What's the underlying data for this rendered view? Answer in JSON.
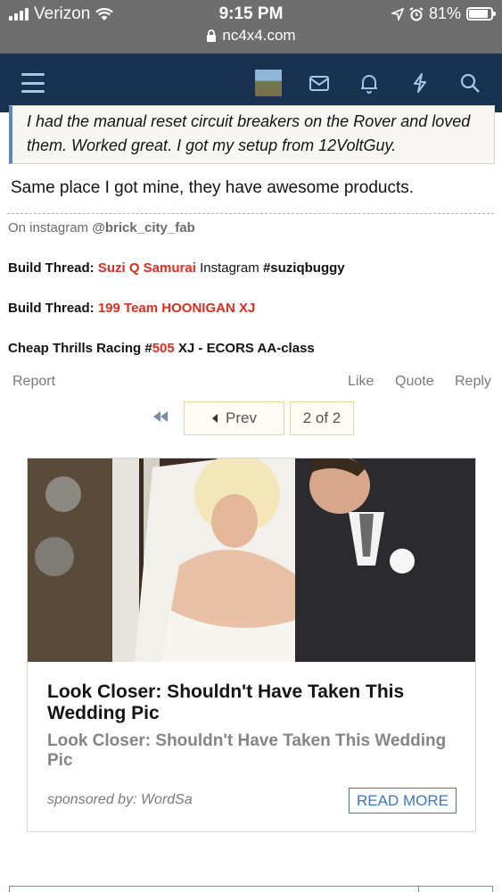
{
  "status_bar": {
    "carrier": "Verizon",
    "time": "9:15 PM",
    "battery": "81%",
    "url": "nc4x4.com"
  },
  "nav": {
    "icons": [
      "menu-icon",
      "avatar",
      "inbox-icon",
      "bell-icon",
      "whats-new-icon",
      "search-icon"
    ]
  },
  "post": {
    "quote": "I had the manual reset circuit breakers on the Rover and loved them. Worked great. I got my setup from 12VoltGuy.",
    "text": "Same place I got mine, they have awesome products."
  },
  "signature": {
    "line1_prefix": "On instagram",
    "line1_handle": "@brick_city_fab",
    "line2_label": "Build Thread:",
    "line2_link": "Suzi Q Samurai",
    "line2_mid": "Instagram",
    "line2_tag": "#suziqbuggy",
    "line3_label": "Build Thread:",
    "line3_link": "199 Team HOONIGAN XJ",
    "line4_prefix": "Cheap Thrills Racing #",
    "line4_num": "505",
    "line4_suffix": "XJ - ECORS AA-class"
  },
  "actions": {
    "report": "Report",
    "like": "Like",
    "quote": "Quote",
    "reply": "Reply"
  },
  "pagination": {
    "prev": "Prev",
    "page": "2 of 2"
  },
  "ad": {
    "title": "Look Closer: Shouldn't Have Taken This Wedding Pic",
    "subtitle": "Look Closer: Shouldn't Have Taken This Wedding Pic",
    "sponsored": "sponsored by: WordSa",
    "button": "READ MORE"
  },
  "colors": {
    "nav_bg": "#19324f",
    "link_red": "#e02b1f",
    "quote_border": "#5c87b6",
    "ad_button": "#3c78c3"
  }
}
